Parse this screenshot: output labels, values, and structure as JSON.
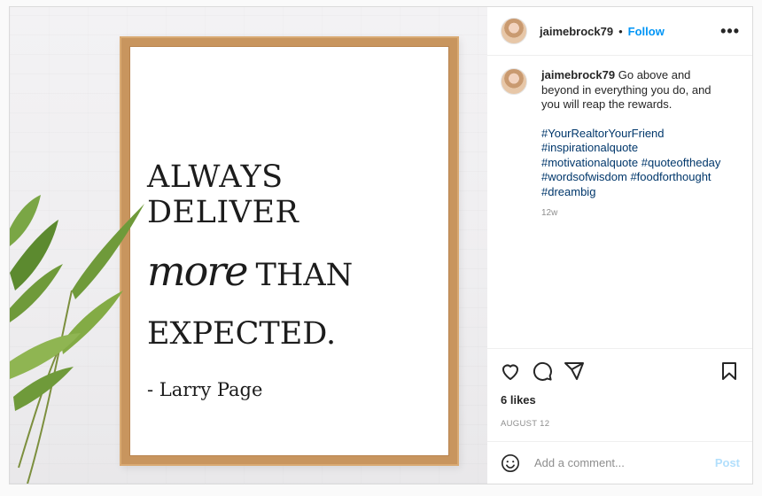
{
  "post": {
    "image": {
      "quote_line1": "ALWAYS DELIVER",
      "quote_script_word": "more",
      "quote_line2_rest": "THAN",
      "quote_line3": "EXPECTED.",
      "author": "- Larry Page"
    },
    "header": {
      "username": "jaimebrock79",
      "separator": "•",
      "follow_label": "Follow",
      "more_icon": "more-options-icon",
      "more_glyph": "•••"
    },
    "caption": {
      "username": "jaimebrock79",
      "text": "Go above and beyond in everything you do, and you will reap the rewards.",
      "hashtags": [
        "#YourRealtorYourFriend",
        "#inspirationalquote",
        "#motivationalquote",
        "#quoteoftheday",
        "#wordsofwisdom",
        "#foodforthought",
        "#dreambig"
      ],
      "time_ago": "12w"
    },
    "actions": {
      "icons": [
        "heart-icon",
        "comment-icon",
        "share-icon",
        "bookmark-icon"
      ]
    },
    "likes": "6 likes",
    "date": "AUGUST 12",
    "add_comment": {
      "placeholder": "Add a comment...",
      "post_label": "Post"
    },
    "colors": {
      "follow_blue": "#0095f6",
      "hashtag_blue": "#00376b",
      "post_disabled": "#b2dffc",
      "frame_wood": "#c8955e"
    }
  }
}
